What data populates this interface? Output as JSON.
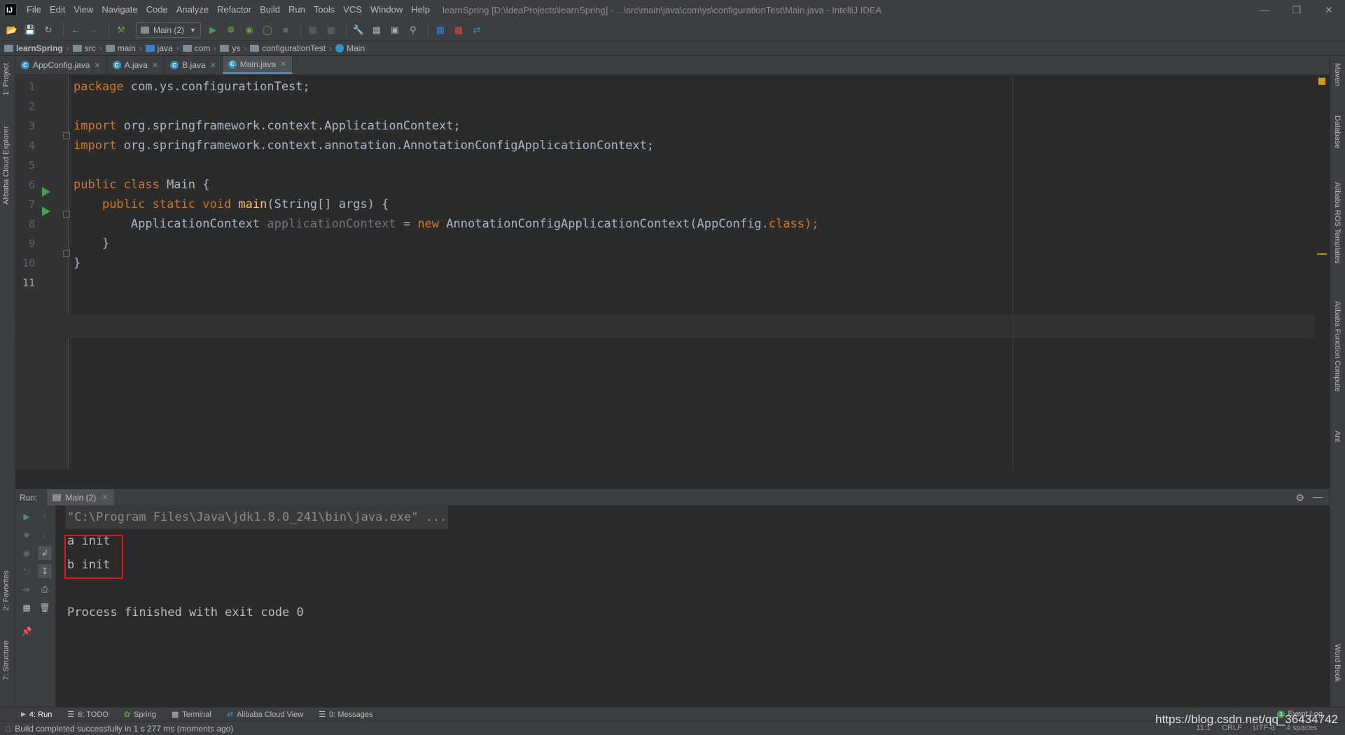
{
  "menubar": {
    "logo": "IJ",
    "items": [
      "File",
      "Edit",
      "View",
      "Navigate",
      "Code",
      "Analyze",
      "Refactor",
      "Build",
      "Run",
      "Tools",
      "VCS",
      "Window",
      "Help"
    ],
    "title": "learnSpring [D:\\IdeaProjects\\learnSpring] - ...\\src\\main\\java\\com\\ys\\configurationTest\\Main.java - IntelliJ IDEA"
  },
  "toolbar": {
    "run_config": "Main (2)"
  },
  "breadcrumb": [
    "learnSpring",
    "src",
    "main",
    "java",
    "com",
    "ys",
    "configurationTest",
    "Main"
  ],
  "left_strip": {
    "project": "1: Project",
    "cloud_explorer": "Alibaba Cloud Explorer",
    "favorites": "2: Favorites",
    "structure": "7: Structure"
  },
  "right_strip": {
    "maven": "Maven",
    "database": "Database",
    "ros": "Alibaba ROS Templates",
    "function_compute": "Alibaba Function Compute",
    "ant": "Ant",
    "word_book": "Word Book"
  },
  "tabs": [
    {
      "label": "AppConfig.java",
      "active": false
    },
    {
      "label": "A.java",
      "active": false
    },
    {
      "label": "B.java",
      "active": false
    },
    {
      "label": "Main.java",
      "active": true
    }
  ],
  "editor": {
    "line_numbers": [
      "1",
      "2",
      "3",
      "4",
      "5",
      "6",
      "7",
      "8",
      "9",
      "10",
      "11"
    ],
    "lines": {
      "l1_kw": "package",
      "l1_rest": " com.ys.configurationTest;",
      "l3_kw": "import",
      "l3_rest": " org.springframework.context.ApplicationContext;",
      "l4_kw": "import",
      "l4_rest": " org.springframework.context.annotation.AnnotationConfigApplicationContext;",
      "l6_kw": "public class",
      "l6_rest": " Main {",
      "l7_indent": "    ",
      "l7_kw": "public static void",
      "l7_sp": " ",
      "l7_fn": "main",
      "l7_rest": "(String[] args) {",
      "l8_indent": "        ",
      "l8_type": "ApplicationContext ",
      "l8_var": "applicationContext",
      "l8_eq": " = ",
      "l8_new": "new",
      "l8_ctor": " AnnotationConfigApplicationContext(AppConfig.",
      "l8_class": "class",
      "l8_end": ");",
      "l9": "    }",
      "l10": "}"
    }
  },
  "run_panel": {
    "title": "Run:",
    "tab": "Main (2)",
    "console": {
      "cmd": "\"C:\\Program Files\\Java\\jdk1.8.0_241\\bin\\java.exe\" ...",
      "line1": "a init",
      "line2": "b init",
      "exit": "Process finished with exit code 0"
    }
  },
  "bottom_tools": [
    {
      "label": "4: Run"
    },
    {
      "label": "6: TODO"
    },
    {
      "label": "Spring"
    },
    {
      "label": "Terminal"
    },
    {
      "label": "Alibaba Cloud View"
    },
    {
      "label": "0: Messages"
    }
  ],
  "event_log": {
    "count": "1",
    "label": "Event Log"
  },
  "statusbar": {
    "message": "Build completed successfully in 1 s 277 ms (moments ago)",
    "position": "11:1",
    "line_sep": "CRLF",
    "encoding": "UTF-8",
    "indent": "4 spaces"
  },
  "watermark": "https://blog.csdn.net/qq_36434742",
  "colors": {
    "keyword": "#cc7832",
    "function": "#ffc66d",
    "text": "#a9b7c6",
    "highlight_box": "#e01818",
    "run_green": "#499c54"
  }
}
